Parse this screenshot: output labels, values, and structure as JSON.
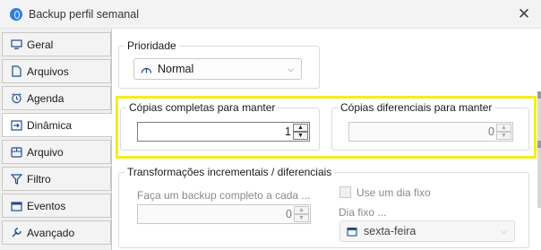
{
  "window": {
    "title": "Backup perfil semanal",
    "close_symbol": "✕",
    "app_icon": "backup-app-icon"
  },
  "tabs": [
    {
      "label": "Geral",
      "icon": "monitor-icon"
    },
    {
      "label": "Arquivos",
      "icon": "file-icon"
    },
    {
      "label": "Agenda",
      "icon": "alarm-clock-icon"
    },
    {
      "label": "Dinâmica",
      "icon": "login-arrow-icon",
      "active": true
    },
    {
      "label": "Arquivo",
      "icon": "archive-box-icon"
    },
    {
      "label": "Filtro",
      "icon": "funnel-icon"
    },
    {
      "label": "Eventos",
      "icon": "calendar-icon"
    },
    {
      "label": "Avançado",
      "icon": "wrench-icon"
    }
  ],
  "priority": {
    "label": "Prioridade",
    "selected": "Normal",
    "icon": "gauge-icon"
  },
  "full_copies": {
    "label": "Cópias completas para manter",
    "value": "1"
  },
  "diff_copies": {
    "label": "Cópias diferenciais para manter",
    "value": "0"
  },
  "incremental": {
    "label": "Transformações incrementais / diferenciais",
    "every_label": "Faça um backup completo a cada ...",
    "every_value": "0",
    "use_fixed_day_label": "Use um dia fixo",
    "use_fixed_day_checked": false,
    "fixed_day_label": "Dia fixo ...",
    "fixed_day_value": "sexta-feira",
    "fixed_day_icon": "calendar-icon"
  },
  "colors": {
    "highlight": "#f2ee1e",
    "accent": "#2f7fe0"
  }
}
